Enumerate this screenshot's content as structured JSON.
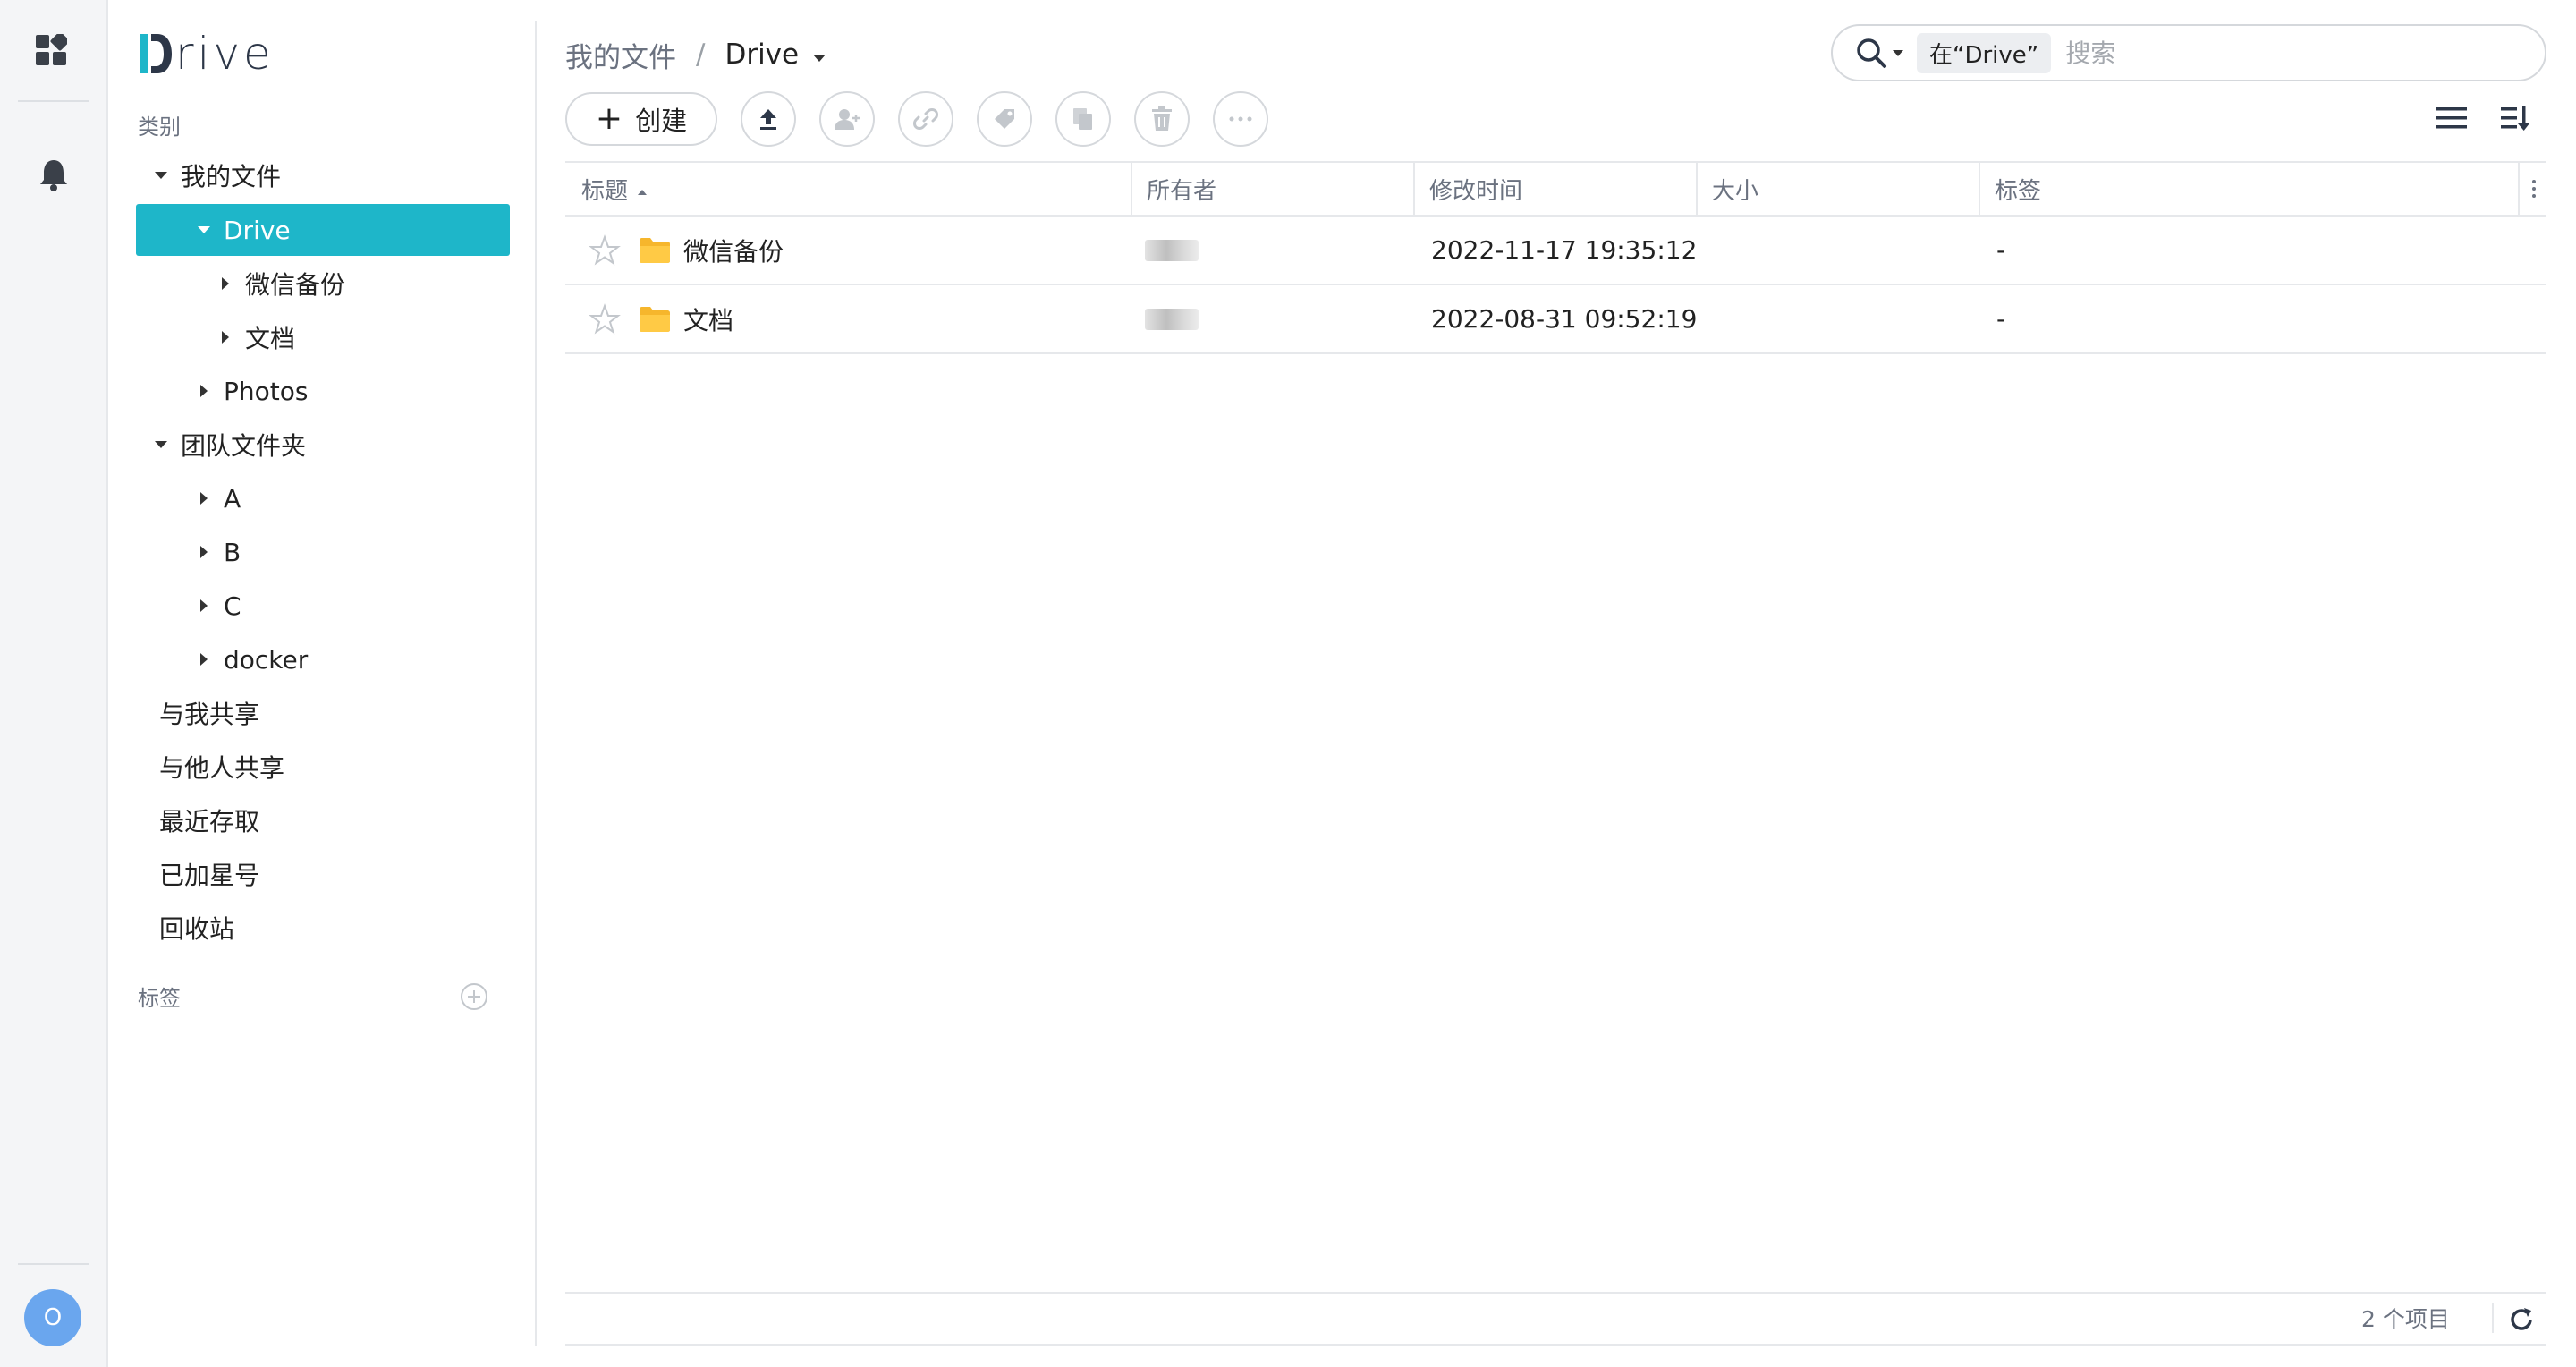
{
  "app": {
    "logo_text": "rive",
    "logo_full": "Drive",
    "brand_color": "#1eb6c9"
  },
  "rail": {
    "avatar_letter": "O",
    "icons": [
      "apps-icon",
      "bell-icon"
    ]
  },
  "sidebar": {
    "category_label": "类别",
    "tree": [
      {
        "label": "我的文件",
        "level": 0,
        "expanded": true
      },
      {
        "label": "Drive",
        "level": 1,
        "expanded": true,
        "selected": true
      },
      {
        "label": "微信备份",
        "level": 2,
        "expanded": false
      },
      {
        "label": "文档",
        "level": 2,
        "expanded": false
      },
      {
        "label": "Photos",
        "level": 1,
        "expanded": false
      },
      {
        "label": "团队文件夹",
        "level": 0,
        "expanded": true
      },
      {
        "label": "A",
        "level": 1,
        "expanded": false
      },
      {
        "label": "B",
        "level": 1,
        "expanded": false
      },
      {
        "label": "C",
        "level": 1,
        "expanded": false
      },
      {
        "label": "docker",
        "level": 1,
        "expanded": false
      }
    ],
    "links": [
      "与我共享",
      "与他人共享",
      "最近存取",
      "已加星号",
      "回收站"
    ],
    "tags_label": "标签"
  },
  "breadcrumb": {
    "parent": "我的文件",
    "separator": "/",
    "current": "Drive"
  },
  "toolbar": {
    "create_label": "创建",
    "icons": [
      "upload-icon",
      "share-user-icon",
      "link-icon",
      "tag-icon",
      "copy-icon",
      "trash-icon",
      "more-icon"
    ]
  },
  "search": {
    "scope": "在“Drive”",
    "placeholder": "搜索"
  },
  "table": {
    "columns": [
      "标题",
      "所有者",
      "修改时间",
      "大小",
      "标签"
    ],
    "sorted_column": "标题",
    "rows": [
      {
        "title": "微信备份",
        "modified": "2022-11-17 19:35:12",
        "size": "",
        "tags": "-"
      },
      {
        "title": "文档",
        "modified": "2022-08-31 09:52:19",
        "size": "",
        "tags": "-"
      }
    ]
  },
  "footer": {
    "item_count": "2 个项目"
  }
}
